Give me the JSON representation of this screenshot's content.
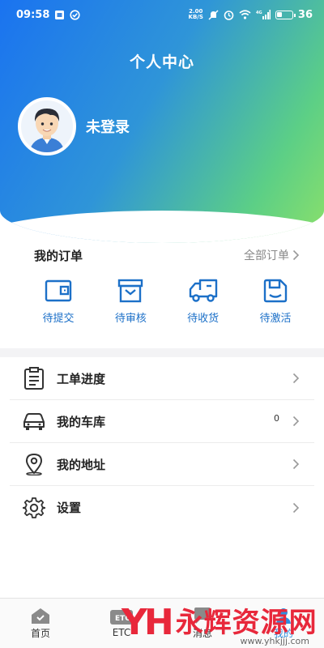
{
  "status_bar": {
    "time": "09:58",
    "net_speed_value": "2.00",
    "net_speed_unit": "KB/S",
    "network": "4G",
    "battery": "36"
  },
  "header": {
    "title": "个人中心",
    "login_status": "未登录"
  },
  "orders": {
    "title": "我的订单",
    "all_orders_label": "全部订单",
    "items": [
      {
        "label": "待提交",
        "icon": "wallet-icon"
      },
      {
        "label": "待审核",
        "icon": "inbox-icon"
      },
      {
        "label": "待收货",
        "icon": "truck-icon"
      },
      {
        "label": "待激活",
        "icon": "save-icon"
      }
    ]
  },
  "menu": {
    "items": [
      {
        "label": "工单进度",
        "icon": "clipboard-icon",
        "badge": ""
      },
      {
        "label": "我的车库",
        "icon": "car-icon",
        "badge": "0"
      },
      {
        "label": "我的地址",
        "icon": "location-pin-icon",
        "badge": ""
      },
      {
        "label": "设置",
        "icon": "gear-icon",
        "badge": ""
      }
    ]
  },
  "tabbar": {
    "tabs": [
      {
        "label": "首页",
        "icon": "home-icon"
      },
      {
        "label": "ETC",
        "icon": "etc-card-icon"
      },
      {
        "label": "消息",
        "icon": "message-icon"
      },
      {
        "label": "我的",
        "icon": "user-icon"
      }
    ],
    "active_index": 3
  },
  "watermark": {
    "logo": "YH",
    "text": "永辉资源网",
    "url": "www.yhkjjj.com"
  },
  "colors": {
    "gradient_start": "#1a73f0",
    "gradient_end": "#8be06a",
    "order_icon": "#1c70c8",
    "watermark_red": "#e8283b"
  }
}
